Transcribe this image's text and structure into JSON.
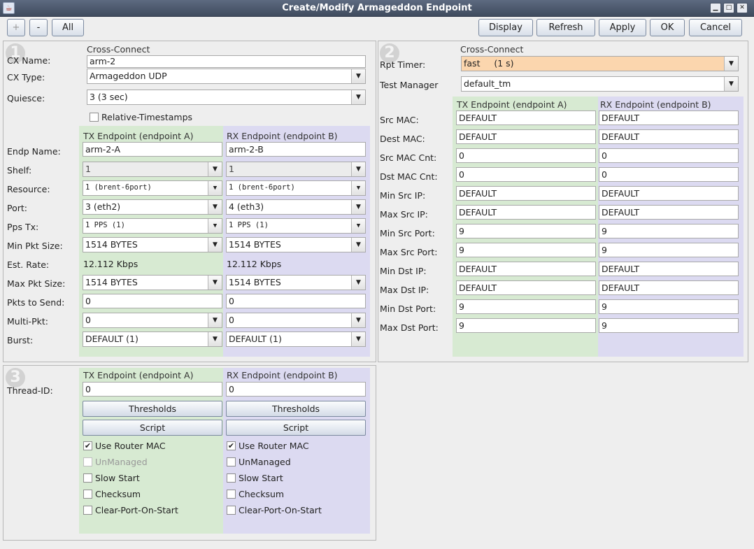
{
  "window": {
    "title": "Create/Modify Armageddon Endpoint",
    "icon": "java-icon"
  },
  "toolbar": {
    "plus": "+",
    "minus": "-",
    "all": "All",
    "display": "Display",
    "refresh": "Refresh",
    "apply": "Apply",
    "ok": "OK",
    "cancel": "Cancel"
  },
  "p1": {
    "num": "1",
    "cx_header": "Cross-Connect",
    "cx_name_label": "CX Name:",
    "cx_name": "arm-2",
    "cx_type_label": "CX Type:",
    "cx_type": "Armageddon UDP",
    "quiesce_label": "Quiesce:",
    "quiesce": "3 (3 sec)",
    "rel_ts_label": "Relative-Timestamps",
    "tx_header": "TX Endpoint (endpoint A)",
    "rx_header": "RX Endpoint (endpoint B)",
    "labels": {
      "endp_name": "Endp Name:",
      "shelf": "Shelf:",
      "resource": "Resource:",
      "port": "Port:",
      "pps_tx": "Pps Tx:",
      "min_pkt": "Min Pkt Size:",
      "est_rate": "Est. Rate:",
      "max_pkt": "Max Pkt Size:",
      "pkts_send": "Pkts to Send:",
      "multi_pkt": "Multi-Pkt:",
      "burst": "Burst:"
    },
    "tx": {
      "endp_name": "arm-2-A",
      "shelf": "1",
      "resource": "1 (brent-6port)",
      "port": "3 (eth2)",
      "pps_tx": "1 PPS (1)",
      "min_pkt": "1514 BYTES",
      "est_rate": "12.112 Kbps",
      "max_pkt": "1514 BYTES",
      "pkts_send": "0",
      "multi_pkt": "0",
      "burst": "DEFAULT (1)"
    },
    "rx": {
      "endp_name": "arm-2-B",
      "shelf": "1",
      "resource": "1 (brent-6port)",
      "port": "4 (eth3)",
      "pps_tx": "1 PPS (1)",
      "min_pkt": "1514 BYTES",
      "est_rate": "12.112 Kbps",
      "max_pkt": "1514 BYTES",
      "pkts_send": "0",
      "multi_pkt": "0",
      "burst": "DEFAULT (1)"
    }
  },
  "p2": {
    "num": "2",
    "cx_header": "Cross-Connect",
    "rpt_label": "Rpt Timer:",
    "rpt": "fast     (1 s)",
    "tm_label": "Test Manager",
    "tm": "default_tm",
    "tx_header": "TX Endpoint (endpoint A)",
    "rx_header": "RX Endpoint (endpoint B)",
    "rows": [
      {
        "label": "Src MAC:",
        "tx": "DEFAULT",
        "rx": "DEFAULT"
      },
      {
        "label": "Dest MAC:",
        "tx": "DEFAULT",
        "rx": "DEFAULT"
      },
      {
        "label": "Src MAC Cnt:",
        "tx": "0",
        "rx": "0"
      },
      {
        "label": "Dst MAC Cnt:",
        "tx": "0",
        "rx": "0"
      },
      {
        "label": "Min Src IP:",
        "tx": "DEFAULT",
        "rx": "DEFAULT"
      },
      {
        "label": "Max Src IP:",
        "tx": "DEFAULT",
        "rx": "DEFAULT"
      },
      {
        "label": "Min Src Port:",
        "tx": "9",
        "rx": "9"
      },
      {
        "label": "Max Src Port:",
        "tx": "9",
        "rx": "9"
      },
      {
        "label": "Min Dst IP:",
        "tx": "DEFAULT",
        "rx": "DEFAULT"
      },
      {
        "label": "Max Dst IP:",
        "tx": "DEFAULT",
        "rx": "DEFAULT"
      },
      {
        "label": "Min Dst Port:",
        "tx": "9",
        "rx": "9"
      },
      {
        "label": "Max Dst Port:",
        "tx": "9",
        "rx": "9"
      }
    ]
  },
  "p3": {
    "num": "3",
    "tx_header": "TX Endpoint (endpoint A)",
    "rx_header": "RX Endpoint (endpoint B)",
    "thread_label": "Thread-ID:",
    "tx_thread": "0",
    "rx_thread": "0",
    "thresholds": "Thresholds",
    "script": "Script",
    "tx_checks": [
      {
        "label": "Use Router MAC",
        "checked": true,
        "disabled": false
      },
      {
        "label": "UnManaged",
        "checked": false,
        "disabled": true
      },
      {
        "label": "Slow Start",
        "checked": false,
        "disabled": false
      },
      {
        "label": "Checksum",
        "checked": false,
        "disabled": false
      },
      {
        "label": "Clear-Port-On-Start",
        "checked": false,
        "disabled": false
      }
    ],
    "rx_checks": [
      {
        "label": "Use Router MAC",
        "checked": true,
        "disabled": false
      },
      {
        "label": "UnManaged",
        "checked": false,
        "disabled": false
      },
      {
        "label": "Slow Start",
        "checked": false,
        "disabled": false
      },
      {
        "label": "Checksum",
        "checked": false,
        "disabled": false
      },
      {
        "label": "Clear-Port-On-Start",
        "checked": false,
        "disabled": false
      }
    ]
  },
  "colors": {
    "tx_bg": "#d7ead2",
    "rx_bg": "#dcdaf1",
    "rpt_bg": "#fbd6ae",
    "title_bg": "#4e5a6e"
  }
}
